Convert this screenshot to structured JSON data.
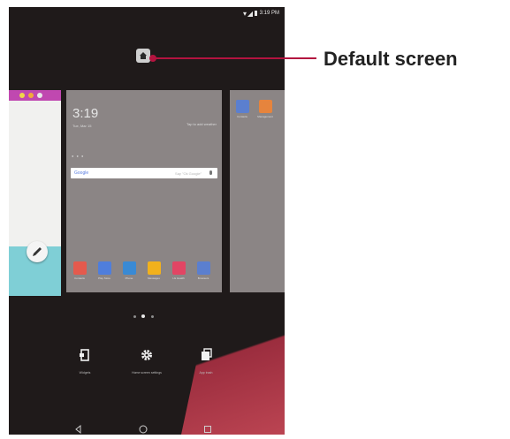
{
  "status_bar": {
    "time": "3:19 PM"
  },
  "callout": {
    "label": "Default screen"
  },
  "default_page": {
    "clock_time": "3:19",
    "clock_date": "Tue, Mar 15",
    "weather_text": "Tap to add weather",
    "search_brand": "Google",
    "search_hint": "Say \"Ok Google\"",
    "apps": [
      {
        "label": "Contacts",
        "color": "#e45a4d"
      },
      {
        "label": "Play Store",
        "color": "#4f7edc"
      },
      {
        "label": "Phone",
        "color": "#3a8ad4"
      },
      {
        "label": "Messages",
        "color": "#f2b11c"
      },
      {
        "label": "LG Health",
        "color": "#e24564"
      },
      {
        "label": "Browsers",
        "color": "#5b7fcf"
      }
    ]
  },
  "next_page": {
    "apps": [
      {
        "label": "Contacts",
        "color": "#5b7fcf"
      },
      {
        "label": "Management",
        "color": "#e6843d"
      }
    ]
  },
  "page_indicator": {
    "count": 3,
    "active_index": 1
  },
  "options": [
    {
      "label": "Widgets",
      "icon": "widgets-icon"
    },
    {
      "label": "Home screen settings",
      "icon": "gear-icon"
    },
    {
      "label": "App trash",
      "icon": "app-trash-icon"
    }
  ],
  "navigation": {
    "back_icon": "back-icon",
    "home_icon": "home-icon",
    "recents_icon": "recents-icon"
  },
  "colors": {
    "accent": "#b3143f",
    "panel": "#8b8585",
    "background": "#1f1a1a"
  }
}
